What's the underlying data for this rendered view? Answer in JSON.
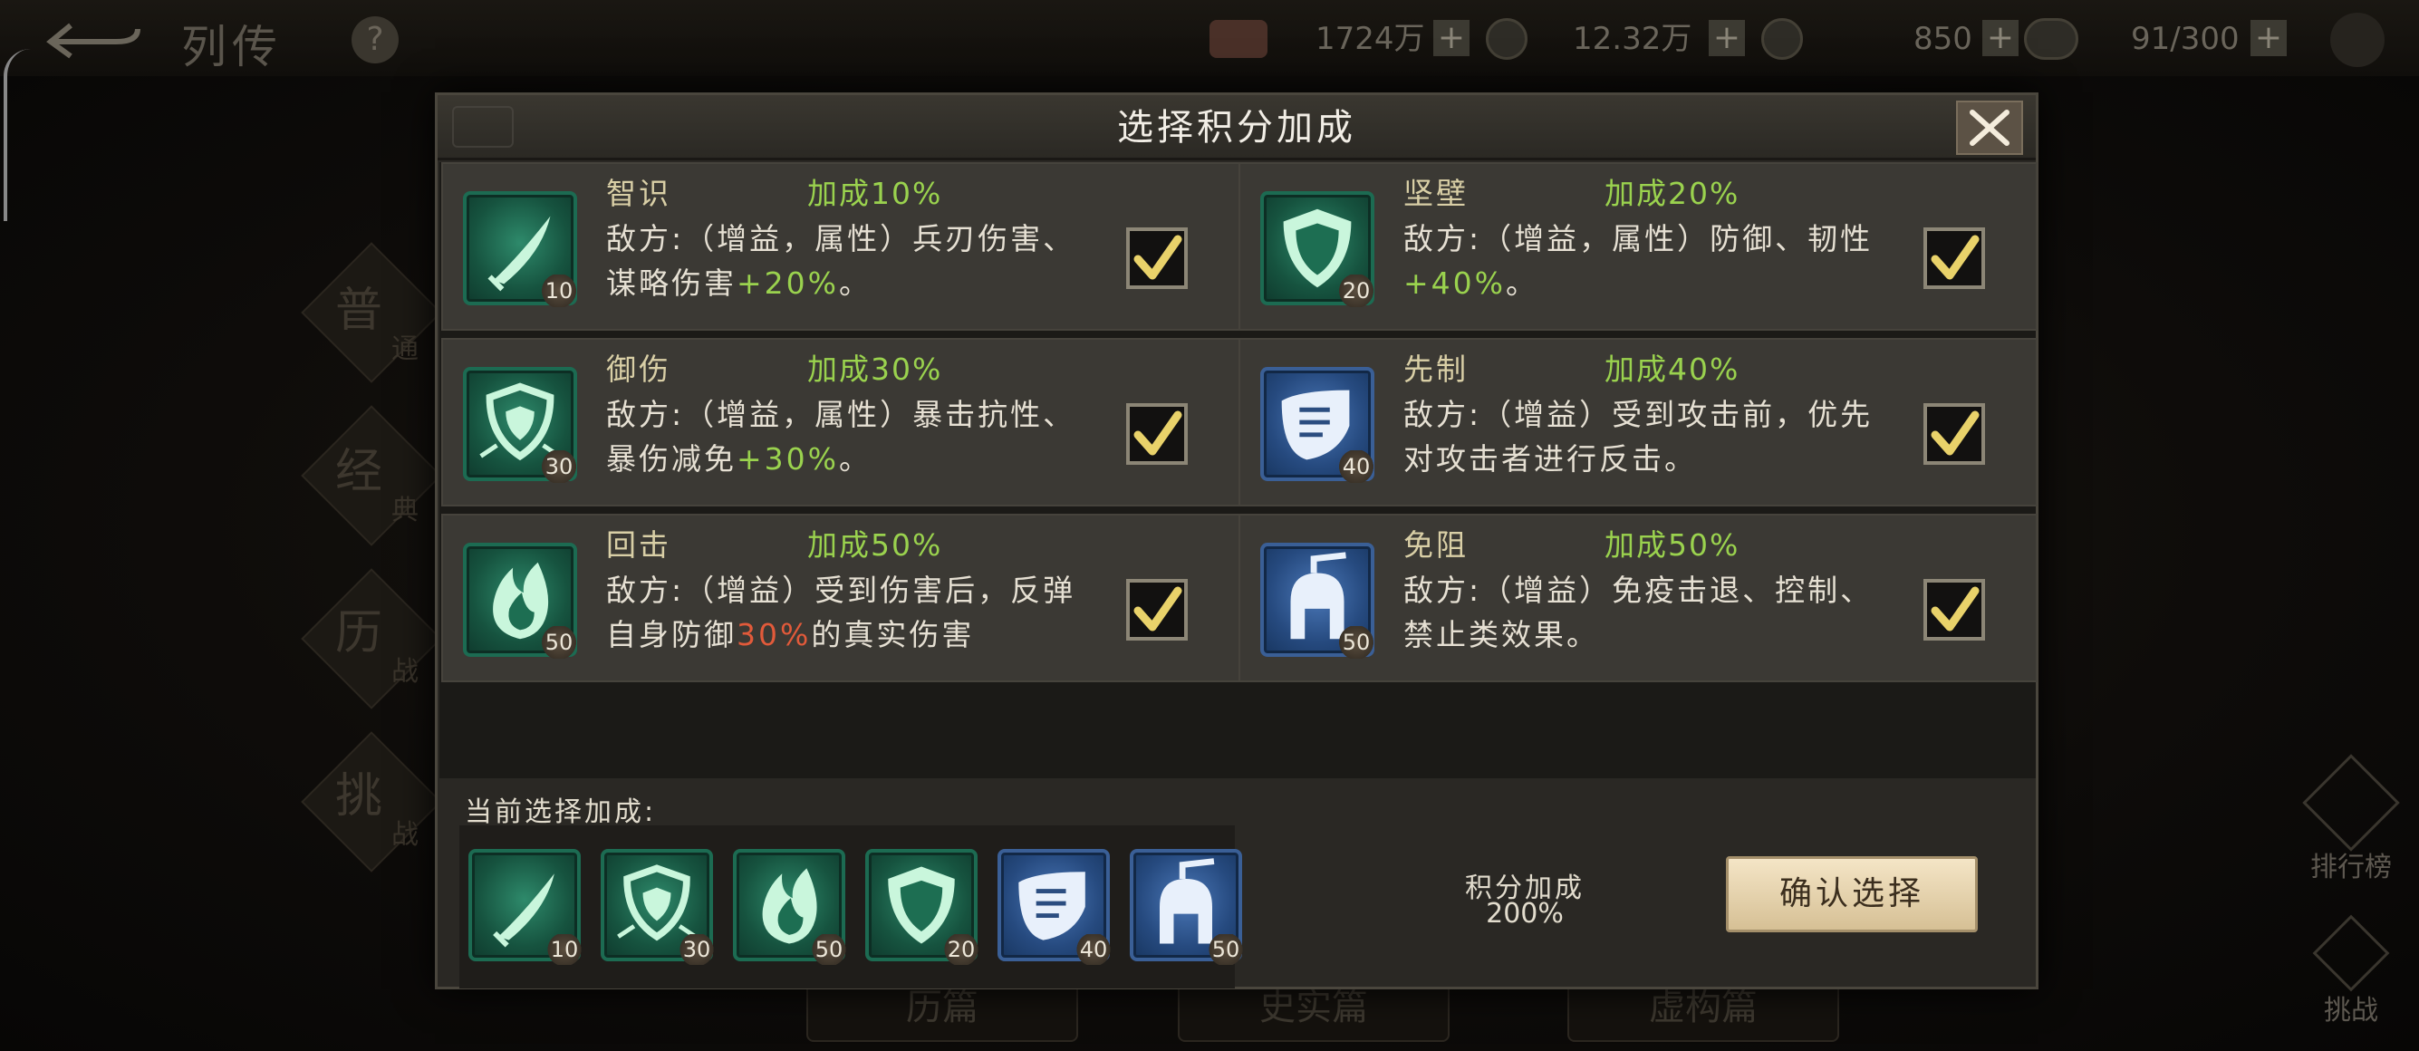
{
  "top_bar": {
    "title": "列传",
    "help_label": "?",
    "resources": [
      {
        "icon": "ingot-icon",
        "value": "1724万",
        "plus": "+"
      },
      {
        "icon": "copper-coin-icon",
        "value": "12.32万",
        "plus": "+"
      },
      {
        "icon": "jade-icon",
        "value": "850",
        "plus": "+"
      },
      {
        "icon": "cloud-token-icon",
        "value": "91/300",
        "plus": "+"
      }
    ]
  },
  "side_tabs": [
    {
      "label": "普",
      "sub": "通"
    },
    {
      "label": "经",
      "sub": "典"
    },
    {
      "label": "历",
      "sub": "战"
    },
    {
      "label": "挑",
      "sub": "战"
    }
  ],
  "right_buttons": {
    "ranking": "排行榜",
    "challenge": "挑战"
  },
  "bottom_tabs": [
    "历篇",
    "史实篇",
    "虚构篇"
  ],
  "modal": {
    "title": "选择积分加成",
    "cards": [
      {
        "name": "智识",
        "bonus": "加成10%",
        "level": "10",
        "icon": "sword-icon",
        "color": "teal",
        "desc_parts": [
          {
            "t": "敌方:（增益，属性）兵刃伤害、谋略伤害"
          },
          {
            "t": "+20%",
            "c": "g"
          },
          {
            "t": "。"
          }
        ],
        "checked": true
      },
      {
        "name": "坚壁",
        "bonus": "加成20%",
        "level": "20",
        "icon": "shield-icon",
        "color": "teal",
        "desc_parts": [
          {
            "t": "敌方:（增益，属性）防御、韧性"
          },
          {
            "t": "+40%",
            "c": "g"
          },
          {
            "t": "。"
          }
        ],
        "checked": true
      },
      {
        "name": "御伤",
        "bonus": "加成30%",
        "level": "30",
        "icon": "guard-shield-icon",
        "color": "teal",
        "desc_parts": [
          {
            "t": "敌方:（增益，属性）暴击抗性、暴伤减免"
          },
          {
            "t": "+30%",
            "c": "g"
          },
          {
            "t": "。"
          }
        ],
        "checked": true
      },
      {
        "name": "先制",
        "bonus": "加成40%",
        "level": "40",
        "icon": "fist-icon",
        "color": "blue",
        "desc_parts": [
          {
            "t": "敌方:（增益）受到攻击前，优先对攻击者进行反击。"
          }
        ],
        "checked": true
      },
      {
        "name": "回击",
        "bonus": "加成50%",
        "level": "50",
        "icon": "flame-icon",
        "color": "teal",
        "desc_parts": [
          {
            "t": "敌方:（增益）受到伤害后，反弹自身防御"
          },
          {
            "t": "30%",
            "c": "r"
          },
          {
            "t": "的真实伤害"
          }
        ],
        "checked": true
      },
      {
        "name": "免阻",
        "bonus": "加成50%",
        "level": "50",
        "icon": "helmet-icon",
        "color": "blue",
        "desc_parts": [
          {
            "t": "敌方:（增益）免疫击退、控制、禁止类效果。"
          }
        ],
        "checked": true
      }
    ],
    "current_label": "当前选择加成:",
    "selected": [
      {
        "icon": "sword-icon",
        "color": "teal",
        "level": "10"
      },
      {
        "icon": "guard-shield-icon",
        "color": "teal",
        "level": "30"
      },
      {
        "icon": "flame-icon",
        "color": "teal",
        "level": "50"
      },
      {
        "icon": "shield-icon",
        "color": "teal",
        "level": "20"
      },
      {
        "icon": "fist-icon",
        "color": "blue",
        "level": "40"
      },
      {
        "icon": "helmet-icon",
        "color": "blue",
        "level": "50"
      }
    ],
    "score_label": "积分加成",
    "score_value": "200%",
    "confirm_label": "确认选择"
  },
  "colors": {
    "bonus_green": "#9ad24e",
    "highlight_red": "#e25a3a",
    "name_gold": "#d9cfa6"
  }
}
